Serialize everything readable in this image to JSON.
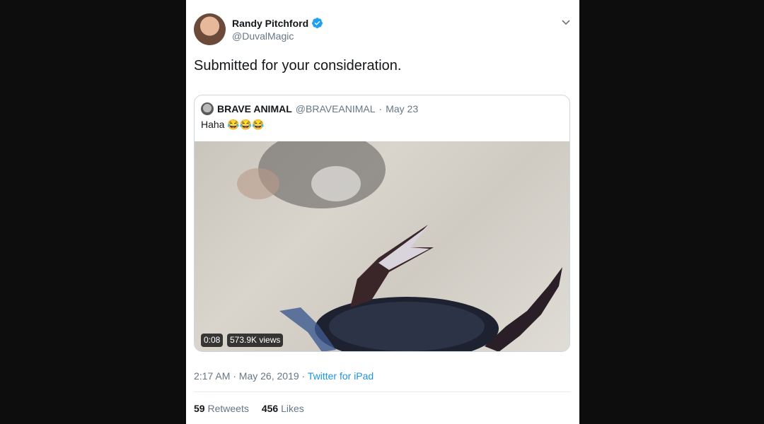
{
  "tweet": {
    "author_name": "Randy Pitchford",
    "author_handle": "@DuvalMagic",
    "text": "Submitted for your consideration.",
    "time": "2:17 AM · May 26, 2019 · ",
    "source": "Twitter for iPad",
    "retweets_count": "59",
    "retweets_label": "Retweets",
    "likes_count": "456",
    "likes_label": "Likes"
  },
  "quoted": {
    "author_name": "BRAVE ANIMAL",
    "author_handle": "@BRAVEANIMAL",
    "separator": "·",
    "date": "May 23",
    "text": "Haha 😂😂😂",
    "video_duration": "0:08",
    "video_views": "573.9K views"
  },
  "icons": {
    "verified": "verified-badge-icon",
    "menu": "chevron-down-icon"
  },
  "colors": {
    "verified": "#1da1f2",
    "link": "#1b95e0",
    "secondary_text": "#657786"
  }
}
